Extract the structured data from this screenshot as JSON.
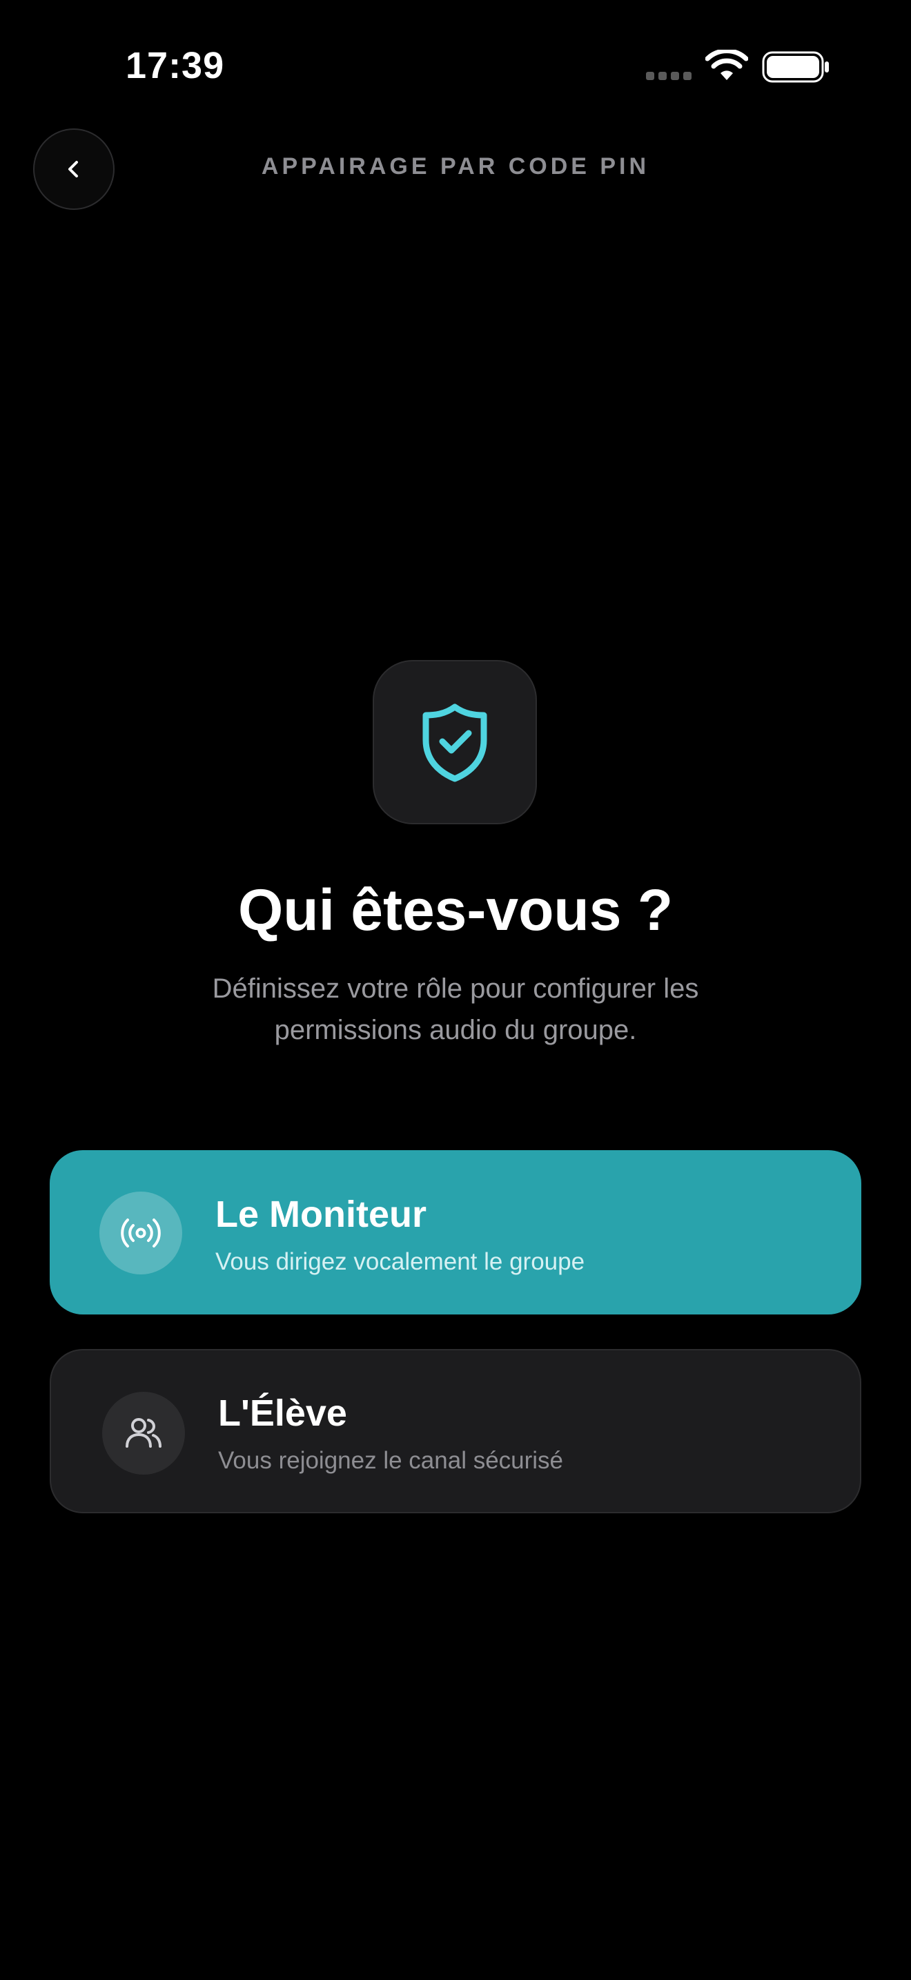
{
  "status_bar": {
    "time": "17:39"
  },
  "header": {
    "title": "APPAIRAGE PAR CODE PIN",
    "back_icon": "chevron-left-icon"
  },
  "hero": {
    "icon": "shield-check-icon",
    "title": "Qui êtes-vous ?",
    "subtitle": "Définissez votre rôle pour configurer les permissions audio du groupe."
  },
  "roles": [
    {
      "title": "Le Moniteur",
      "description": "Vous dirigez vocalement le groupe",
      "icon": "broadcast-icon",
      "selected": true
    },
    {
      "title": "L'Élève",
      "description": "Vous rejoignez le canal sécurisé",
      "icon": "users-icon",
      "selected": false
    }
  ],
  "colors": {
    "background": "#000000",
    "accent": "#29a3ac",
    "shield": "#4fd4e0",
    "card": "#1c1c1e",
    "muted_text": "#8e8e93"
  }
}
